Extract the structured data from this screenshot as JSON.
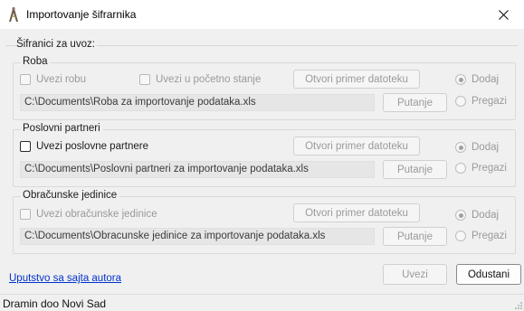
{
  "window": {
    "title": "Importovanje šifrarnika",
    "close_icon": "close-icon",
    "app_icon": "app-logo-icon"
  },
  "import_section": {
    "legend": "Šifranici za uvoz:"
  },
  "groups": [
    {
      "legend": "Roba",
      "checkbox1": "Uvezi robu",
      "checkbox2": "Uvezi u početno stanje",
      "open_sample": "Otvori primer datoteku",
      "path": "C:\\Documents\\Roba za importovanje podataka.xls",
      "path_button": "Putanje",
      "radio_add": "Dodaj",
      "radio_overwrite": "Pregazi"
    },
    {
      "legend": "Poslovni partneri",
      "checkbox1": "Uvezi poslovne partnere",
      "open_sample": "Otvori primer datoteku",
      "path": "C:\\Documents\\Poslovni partneri za importovanje podataka.xls",
      "path_button": "Putanje",
      "radio_add": "Dodaj",
      "radio_overwrite": "Pregazi"
    },
    {
      "legend": "Obračunske jedinice",
      "checkbox1": "Uvezi obračunske jedinice",
      "open_sample": "Otvori primer datoteku",
      "path": "C:\\Documents\\Obracunske jedinice za importovanje podataka.xls",
      "path_button": "Putanje",
      "radio_add": "Dodaj",
      "radio_overwrite": "Pregazi"
    }
  ],
  "footer": {
    "help_link": "Uputstvo sa sajta autora",
    "import_button": "Uvezi",
    "cancel_button": "Odustani"
  },
  "status": {
    "company": "Dramin doo Novi Sad"
  }
}
